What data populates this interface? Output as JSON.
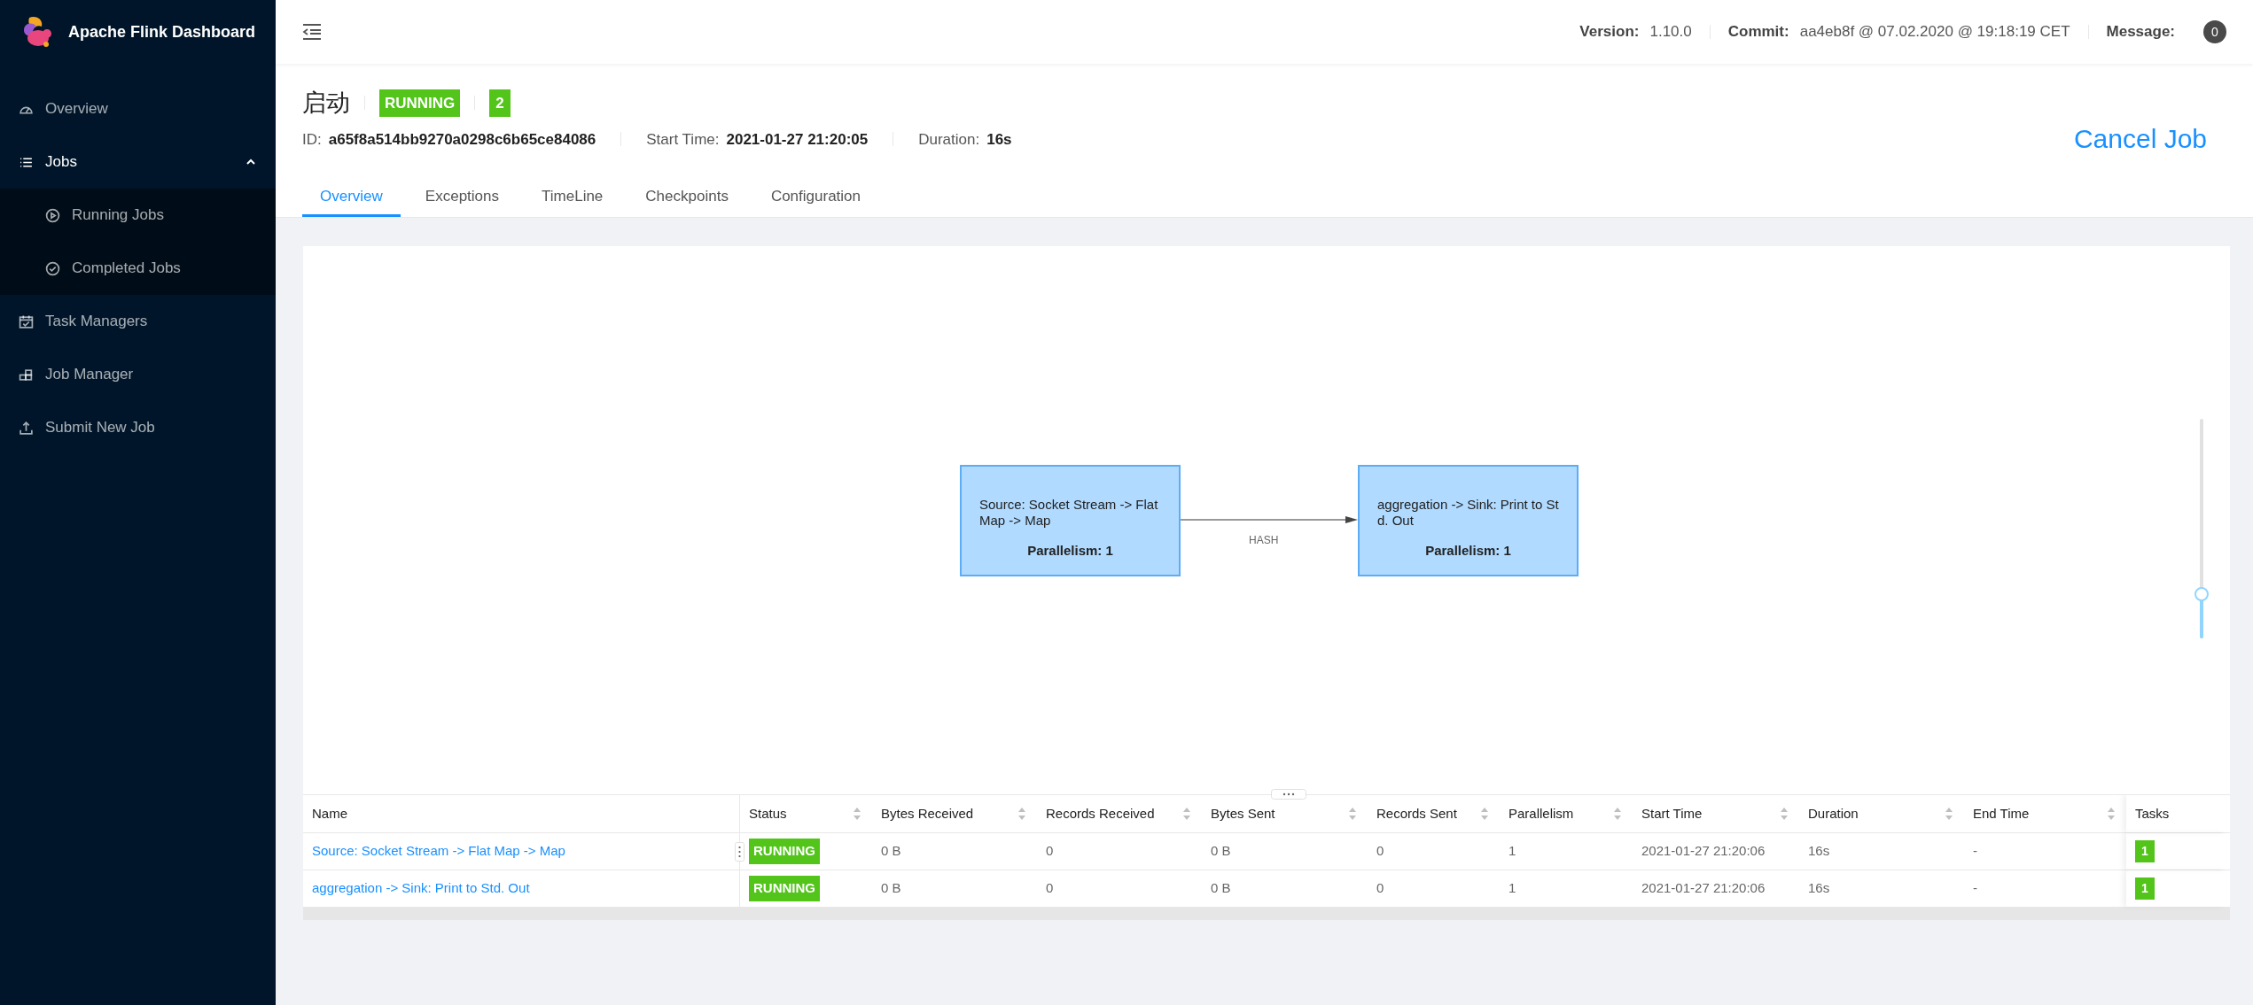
{
  "sidebar": {
    "title": "Apache Flink Dashboard",
    "items": [
      {
        "label": "Overview"
      },
      {
        "label": "Jobs",
        "expanded": true,
        "children": [
          {
            "label": "Running Jobs"
          },
          {
            "label": "Completed Jobs"
          }
        ]
      },
      {
        "label": "Task Managers"
      },
      {
        "label": "Job Manager"
      },
      {
        "label": "Submit New Job"
      }
    ]
  },
  "header": {
    "version_label": "Version:",
    "version": "1.10.0",
    "commit_label": "Commit:",
    "commit": "aa4eb8f @ 07.02.2020 @ 19:18:19 CET",
    "message_label": "Message:",
    "message_count": "0"
  },
  "job": {
    "name": "启动",
    "status": "RUNNING",
    "count": "2",
    "id_label": "ID:",
    "id": "a65f8a514bb9270a0298c6b65ce84086",
    "start_label": "Start Time:",
    "start": "2021-01-27 21:20:05",
    "duration_label": "Duration:",
    "duration": "16s",
    "cancel": "Cancel Job"
  },
  "tabs": [
    {
      "label": "Overview",
      "selected": true
    },
    {
      "label": "Exceptions",
      "selected": false
    },
    {
      "label": "TimeLine",
      "selected": false
    },
    {
      "label": "Checkpoints",
      "selected": false
    },
    {
      "label": "Configuration",
      "selected": false
    }
  ],
  "graph": {
    "nodes": [
      {
        "text": "Source: Socket Stream -> Flat Map -> Map",
        "parallelism": "Parallelism: 1"
      },
      {
        "text": "aggregation -> Sink: Print to Std. Out",
        "parallelism": "Parallelism: 1"
      }
    ],
    "edges": [
      {
        "label": "HASH"
      }
    ],
    "zoom": {
      "level": 0.2
    }
  },
  "table": {
    "columns": [
      {
        "label": "Name",
        "sortable": false
      },
      {
        "label": "Status",
        "sortable": true
      },
      {
        "label": "Bytes Received",
        "sortable": true
      },
      {
        "label": "Records Received",
        "sortable": true
      },
      {
        "label": "Bytes Sent",
        "sortable": true
      },
      {
        "label": "Records Sent",
        "sortable": true
      },
      {
        "label": "Parallelism",
        "sortable": true
      },
      {
        "label": "Start Time",
        "sortable": true
      },
      {
        "label": "Duration",
        "sortable": true
      },
      {
        "label": "End Time",
        "sortable": true
      },
      {
        "label": "Tasks",
        "sortable": false
      }
    ],
    "rows": [
      {
        "name": "Source: Socket Stream -> Flat Map -> Map",
        "status": "RUNNING",
        "bytes_received": "0 B",
        "records_received": "0",
        "bytes_sent": "0 B",
        "records_sent": "0",
        "parallelism": "1",
        "start_time": "2021-01-27 21:20:06",
        "duration": "16s",
        "end_time": "-",
        "tasks": "1"
      },
      {
        "name": "aggregation -> Sink: Print to Std. Out",
        "status": "RUNNING",
        "bytes_received": "0 B",
        "records_received": "0",
        "bytes_sent": "0 B",
        "records_sent": "0",
        "parallelism": "1",
        "start_time": "2021-01-27 21:20:06",
        "duration": "16s",
        "end_time": "-",
        "tasks": "1"
      }
    ]
  }
}
